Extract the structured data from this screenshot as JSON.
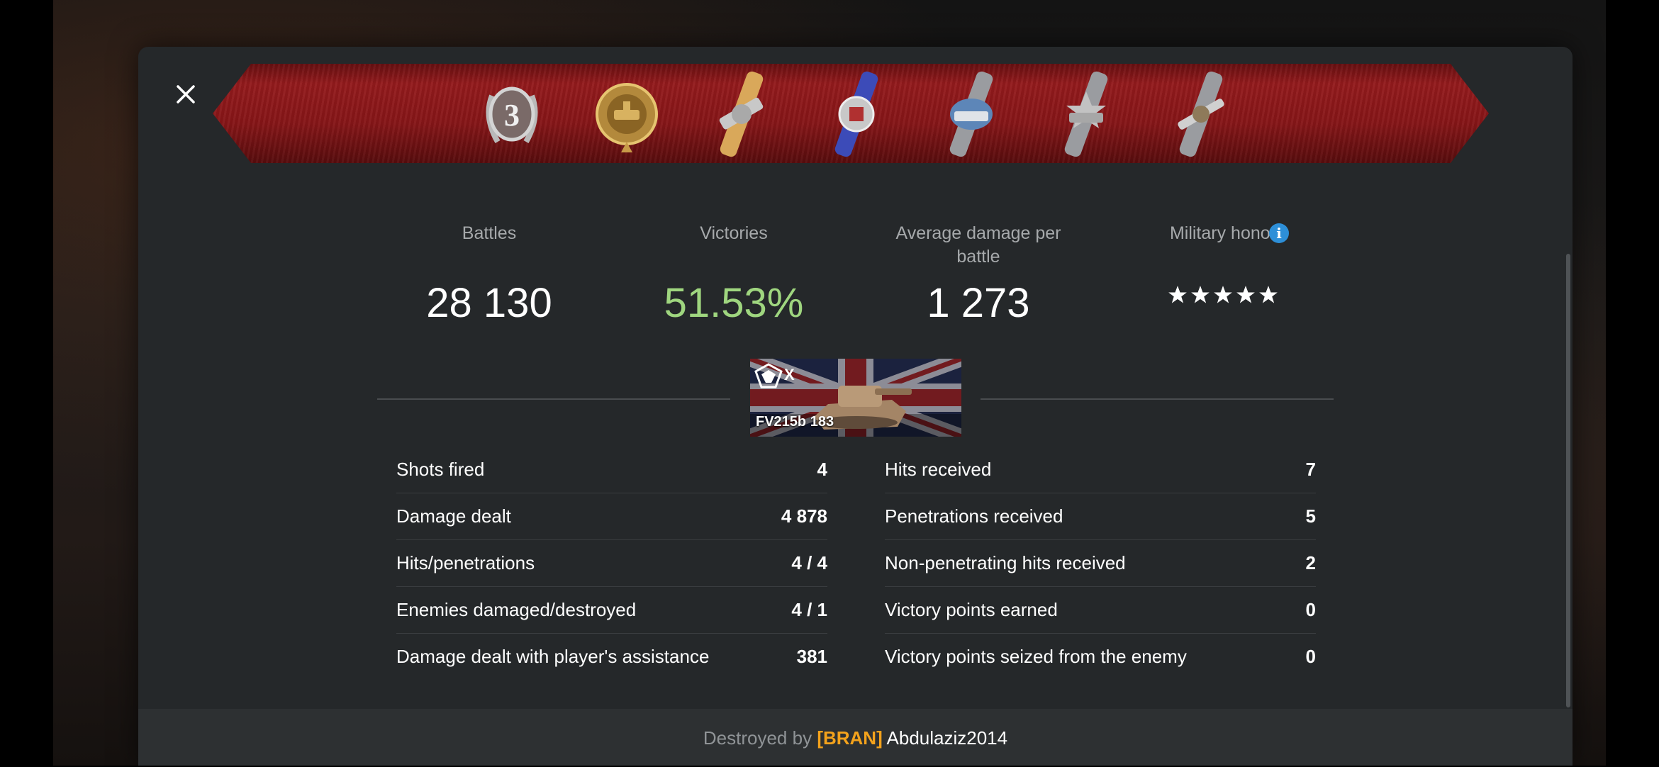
{
  "stats": {
    "battles_label": "Battles",
    "battles_value": "28 130",
    "victories_label": "Victories",
    "victories_value": "51.53%",
    "avg_damage_label_line1": "Average damage per",
    "avg_damage_label_line2": "battle",
    "avg_damage_value": "1 273",
    "honor_label": "Military honor",
    "honor_stars": 5,
    "info_icon": "info-icon"
  },
  "colors": {
    "victories": "#9fd67f",
    "clan": "#f3a21c",
    "accent_info": "#2d8fd8"
  },
  "medals": [
    "mastery-badge-3-icon",
    "tank-expert-medal-icon",
    "gun-ribbon-medal-icon",
    "defender-medal-icon",
    "warrior-medal-icon",
    "top-gun-medal-icon",
    "sniper-medal-icon"
  ],
  "tank": {
    "tier": "X",
    "name": "FV215b 183"
  },
  "left_rows": [
    {
      "label": "Shots fired",
      "value": "4"
    },
    {
      "label": "Damage dealt",
      "value": "4 878"
    },
    {
      "label": "Hits/penetrations",
      "value": "4 / 4"
    },
    {
      "label": "Enemies damaged/destroyed",
      "value": "4 / 1"
    },
    {
      "label": "Damage dealt with player's assistance",
      "value": "381"
    }
  ],
  "right_rows": [
    {
      "label": "Hits received",
      "value": "7"
    },
    {
      "label": "Penetrations received",
      "value": "5"
    },
    {
      "label": "Non-penetrating hits received",
      "value": "2"
    },
    {
      "label": "Victory points earned",
      "value": "0"
    },
    {
      "label": "Victory points seized from the enemy",
      "value": "0"
    }
  ],
  "footer": {
    "prefix": "Destroyed by",
    "clan": "[BRAN]",
    "player": "Abdulaziz2014"
  }
}
